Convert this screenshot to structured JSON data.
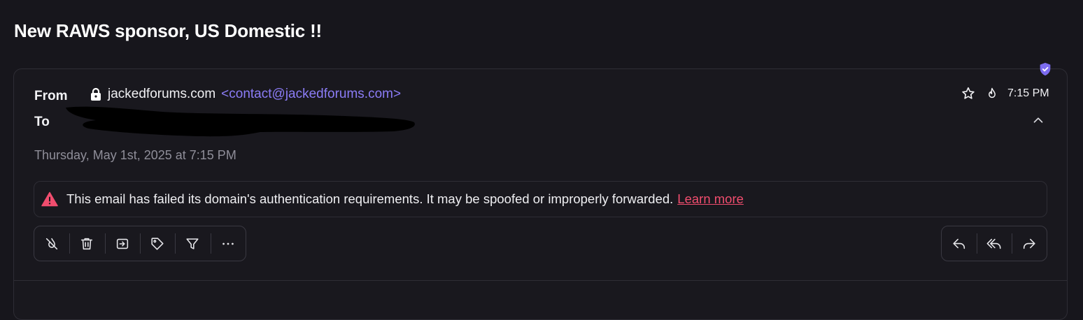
{
  "email": {
    "subject": "New RAWS sponsor, US Domestic !!",
    "from_label": "From",
    "to_label": "To",
    "sender_name": "jackedforums.com",
    "sender_address": "<contact@jackedforums.com>",
    "time": "7:15 PM",
    "date": "Thursday, May 1st, 2025 at 7:15 PM"
  },
  "warning": {
    "message": "This email has failed its domain's authentication requirements. It may be spoofed or improperly forwarded.",
    "link_label": "Learn more"
  },
  "toolbar": {
    "left_actions": [
      "unsnooze-icon",
      "trash-icon",
      "move-to-icon",
      "tag-icon",
      "filter-icon",
      "more-icon"
    ],
    "right_actions": [
      "reply-icon",
      "reply-all-icon",
      "forward-icon"
    ]
  },
  "colors": {
    "background": "#17161c",
    "accent": "#8b7cf6",
    "warning": "#f04d6e"
  }
}
